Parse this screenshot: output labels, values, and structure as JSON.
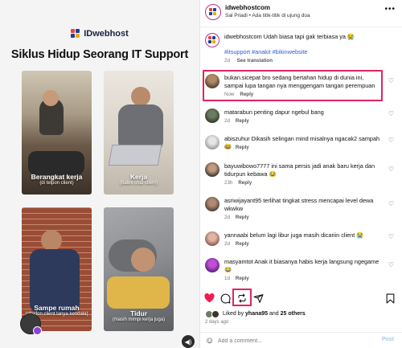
{
  "media": {
    "brand_name": "IDwebhost",
    "headline": "Siklus Hidup Seorang IT Support",
    "panels": [
      {
        "title": "Berangkat kerja",
        "subtitle": "(di telpon client)"
      },
      {
        "title": "Kerja",
        "subtitle": "(bales chat client)"
      },
      {
        "title": "Sampe rumah",
        "subtitle": "(ditelfon client tanya kendala)"
      },
      {
        "title": "Tidur",
        "subtitle": "(masih mimpi kerja juga)"
      }
    ]
  },
  "header": {
    "username": "idwebhostcom",
    "audio": "Sal Priadi • Ada titik-titik di ujung doa",
    "more": "•••"
  },
  "caption": {
    "username": "idwebhostcom",
    "text": "Udah biasa tapi gak terbiasa ya 😭",
    "tags": "#itsupport #anakit #bikinwebsite",
    "age": "2d",
    "translation": "See translation"
  },
  "comments": [
    {
      "username": "bukan.sicepat",
      "text": "bro sedang bertahan hidup di dunia ini, sampai lupa tangan nya menggengam tangan perempuan",
      "age": "Now",
      "reply": "Reply"
    },
    {
      "username": "matarabun",
      "text": "penting dapur ngebul bang",
      "age": "2d",
      "reply": "Reply"
    },
    {
      "username": "abiszuhur",
      "text": "Dikasih selingan mind misalnya ngacak2 sampah😂",
      "age": "6h",
      "reply": "Reply"
    },
    {
      "username": "bayuwibowo7777",
      "text": "ini sama persis jadi anak baru kerja dan tidurpun kebawa 😂",
      "age": "23h",
      "reply": "Reply"
    },
    {
      "username": "asriwijayant95",
      "text": "terlihat tingkat stress mencapai level dewa wkwkw",
      "age": "2d",
      "reply": "Reply"
    },
    {
      "username": "yannaabi",
      "text": "belum lagi libur juga masih dicariin client 😭",
      "age": "2d",
      "reply": "Reply"
    },
    {
      "username": "masyamtot",
      "text": "Anak it biasanya habis kerja langsung ngegame 😂",
      "age": "1d",
      "reply": "Reply"
    }
  ],
  "likes": {
    "prefix": "Liked by",
    "user": "yhana95",
    "and": "and",
    "others": "25 others",
    "age": "2 days ago"
  },
  "composer": {
    "placeholder": "Add a comment...",
    "post_label": "Post"
  },
  "icons": [
    "heart-icon",
    "comment-icon",
    "repost-icon",
    "share-icon",
    "bookmark-icon",
    "smile-icon",
    "sound-icon"
  ],
  "colors": {
    "highlight": "#e0245e",
    "like_red": "#ed1d4f",
    "link_blue": "#2a5bd7",
    "post_disabled": "#a9c5ef"
  }
}
